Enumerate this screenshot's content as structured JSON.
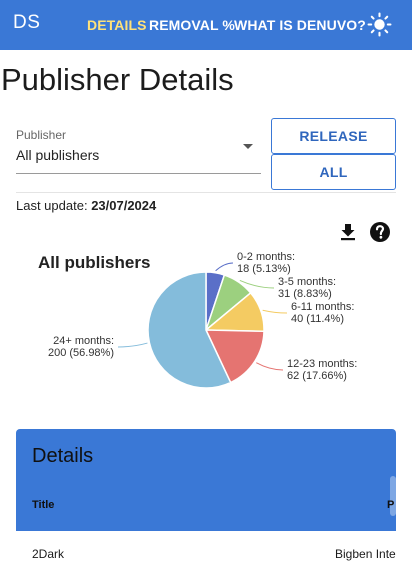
{
  "header": {
    "logo": "DS",
    "nav": [
      {
        "label": "DETAILS",
        "color": "#ffe27a",
        "active": true
      },
      {
        "label": "REMOVAL %",
        "color": "#ffffff",
        "active": false
      },
      {
        "label": "WHAT IS DENUVO?",
        "color": "#ffffff",
        "active": false
      }
    ],
    "theme_icon": "sun-icon",
    "background": "#3a78d6"
  },
  "page_title": "Publisher Details",
  "filter": {
    "label": "Publisher",
    "value": "All publishers"
  },
  "buttons": {
    "release": "RELEASE",
    "all": "ALL"
  },
  "last_update": {
    "label": "Last update:",
    "value": "23/07/2024"
  },
  "icons": {
    "download": "download-icon",
    "help": "help-icon"
  },
  "chart_data": {
    "type": "pie",
    "title": "All publishers",
    "slices": [
      {
        "label": "0-2 months:",
        "value": 18,
        "percent": "(5.13%)",
        "color": "#5a6fc8"
      },
      {
        "label": "3-5 months:",
        "value": 31,
        "percent": "(8.83%)",
        "color": "#9cd07f"
      },
      {
        "label": "6-11 months:",
        "value": 40,
        "percent": "(11.4%)",
        "color": "#f4cb62"
      },
      {
        "label": "12-23 months:",
        "value": 62,
        "percent": "(17.66%)",
        "color": "#e57471"
      },
      {
        "label": "24+ months:",
        "value": 200,
        "percent": "(56.98%)",
        "color": "#84bcdb"
      }
    ]
  },
  "details": {
    "title": "Details",
    "columns": [
      "Title",
      "P"
    ],
    "rows": [
      {
        "title": "2Dark",
        "publisher": "Bigben Inte"
      }
    ]
  }
}
